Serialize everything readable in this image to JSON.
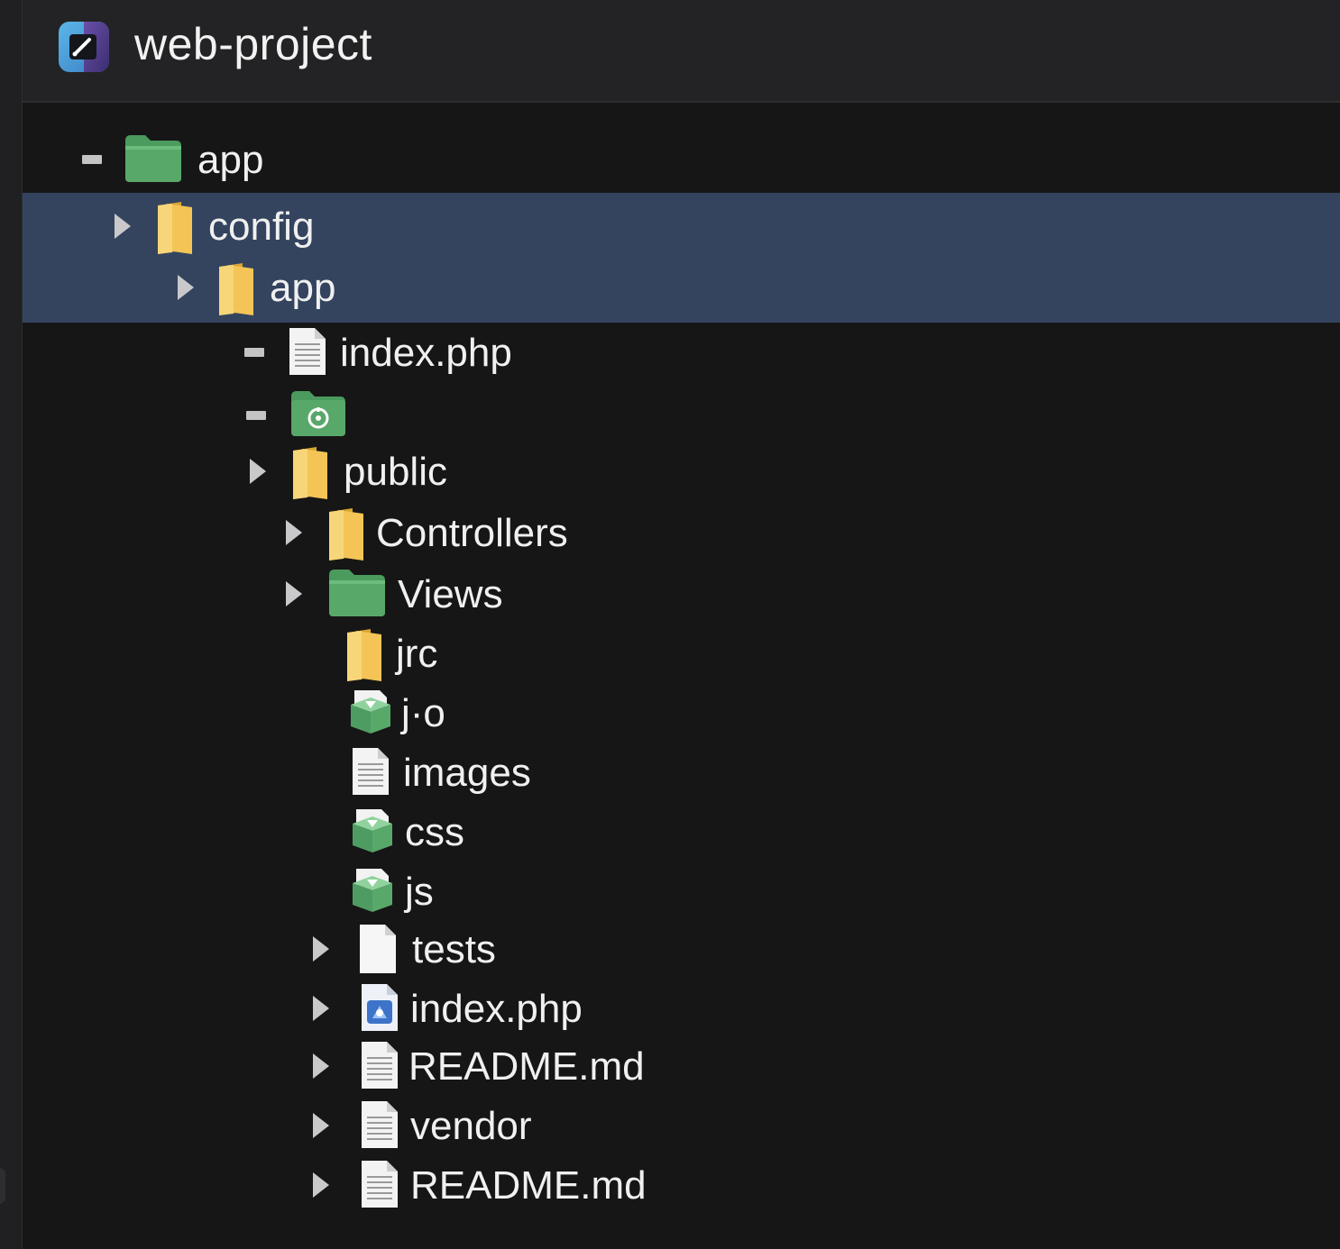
{
  "header": {
    "title": "web-project",
    "icon": "app-logo-icon"
  },
  "colors": {
    "background": "#161616",
    "header": "#232325",
    "selection": "#34445f",
    "folder_yellow": "#f4c556",
    "folder_green": "#58a86a",
    "text": "#f0f0f0"
  },
  "tree": {
    "rows": [
      {
        "label": "app",
        "icon": "green-folder-icon",
        "twisty": "dash"
      },
      {
        "label": "config",
        "icon": "yellow-folder-icon",
        "twisty": "collapsed",
        "selected": true
      },
      {
        "label": "app",
        "icon": "yellow-folder-icon",
        "twisty": "collapsed",
        "selected": true
      },
      {
        "label": "index.php",
        "icon": "document-icon",
        "twisty": "dash"
      },
      {
        "label": "",
        "icon": "green-folder-badge-icon",
        "twisty": "dash"
      },
      {
        "label": "public",
        "icon": "yellow-folder-icon",
        "twisty": "collapsed"
      },
      {
        "label": "Controllers",
        "icon": "yellow-folder-icon",
        "twisty": "collapsed"
      },
      {
        "label": "Views",
        "icon": "green-folder-icon",
        "twisty": "collapsed"
      },
      {
        "label": "jrc",
        "icon": "yellow-folder-icon",
        "twisty": "none"
      },
      {
        "label": "j·o",
        "icon": "green-package-icon",
        "twisty": "none"
      },
      {
        "label": "images",
        "icon": "document-icon",
        "twisty": "none"
      },
      {
        "label": "css",
        "icon": "green-package-icon",
        "twisty": "none"
      },
      {
        "label": "js",
        "icon": "green-package-icon",
        "twisty": "none"
      },
      {
        "label": "tests",
        "icon": "blank-file-icon",
        "twisty": "collapsed"
      },
      {
        "label": "index.php",
        "icon": "php-file-icon",
        "twisty": "collapsed"
      },
      {
        "label": "README.md",
        "icon": "document-icon",
        "twisty": "collapsed"
      },
      {
        "label": "vendor",
        "icon": "document-icon",
        "twisty": "collapsed"
      },
      {
        "label": "README.md",
        "icon": "document-icon",
        "twisty": "collapsed"
      }
    ]
  }
}
